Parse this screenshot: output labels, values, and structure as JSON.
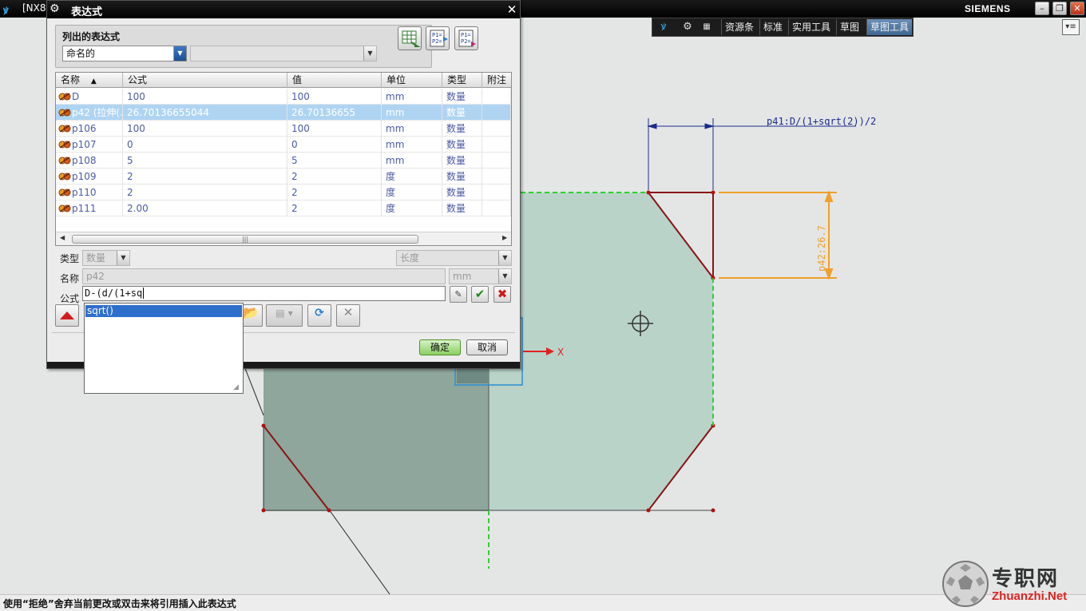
{
  "app": {
    "title": "[NX8",
    "brand": "SIEMENS"
  },
  "toolbar": {
    "tabs": [
      "资源条",
      "标准",
      "实用工具",
      "草图",
      "草图工具"
    ],
    "active_tab": "草图工具"
  },
  "dialog": {
    "title": "表达式",
    "listed_group_title": "列出的表达式",
    "filter_value": "命名的",
    "columns": [
      "名称",
      "公式",
      "值",
      "单位",
      "类型",
      "附注"
    ],
    "rows": [
      {
        "name": "D",
        "formula": "100",
        "value": "100",
        "unit": "mm",
        "type": "数量",
        "note": ""
      },
      {
        "name": "p42 (拉伸(...",
        "formula": "26.70136655044",
        "value": "26.70136655",
        "unit": "mm",
        "type": "数量",
        "note": ""
      },
      {
        "name": "p106",
        "formula": "100",
        "value": "100",
        "unit": "mm",
        "type": "数量",
        "note": ""
      },
      {
        "name": "p107",
        "formula": "0",
        "value": "0",
        "unit": "mm",
        "type": "数量",
        "note": ""
      },
      {
        "name": "p108",
        "formula": "5",
        "value": "5",
        "unit": "mm",
        "type": "数量",
        "note": ""
      },
      {
        "name": "p109",
        "formula": "2",
        "value": "2",
        "unit": "度",
        "type": "数量",
        "note": ""
      },
      {
        "name": "p110",
        "formula": "2",
        "value": "2",
        "unit": "度",
        "type": "数量",
        "note": ""
      },
      {
        "name": "p111",
        "formula": "2.00",
        "value": "2",
        "unit": "度",
        "type": "数量",
        "note": ""
      }
    ],
    "selected_row": 1,
    "type_label": "类型",
    "type_value": "数量",
    "dimension_value": "长度",
    "name_label": "名称",
    "name_value": "p42",
    "unit_value": "mm",
    "formula_label": "公式",
    "formula_value": "D-(d/(1+sq",
    "autocomplete_item": "sqrt()",
    "ok_label": "确定",
    "cancel_label": "取消"
  },
  "drawing": {
    "dimension_top": "p41:D/(1+sqrt(2))/2",
    "dimension_right": "p42:26.7",
    "axis_label": "X",
    "colors": {
      "face_light": "#b9d3c9",
      "face_dark": "#8ea69c",
      "edge": "#8b1414",
      "dim_blue": "#1b2a8a",
      "dim_orange": "#f0a028",
      "constraint_green": "#2ed12e",
      "axis_red": "#e02020"
    }
  },
  "status": {
    "text": "使用“拒绝”舍弃当前更改或双击来将引用插入此表达式"
  },
  "watermark": {
    "cn": "专职网",
    "en": "Zhuanzhi.Net"
  }
}
